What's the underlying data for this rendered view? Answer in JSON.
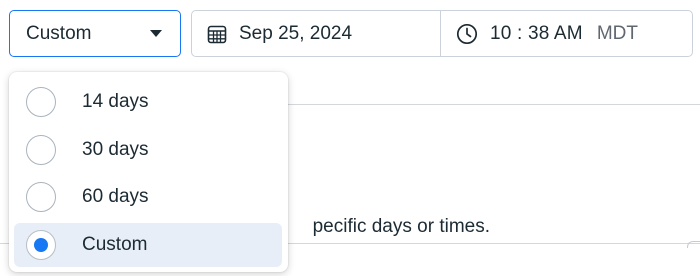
{
  "range_select": {
    "value": "Custom",
    "options": [
      {
        "label": "14 days",
        "selected": false
      },
      {
        "label": "30 days",
        "selected": false
      },
      {
        "label": "60 days",
        "selected": false
      },
      {
        "label": "Custom",
        "selected": true
      }
    ]
  },
  "date": {
    "value": "Sep 25, 2024",
    "icon": "calendar-icon"
  },
  "time": {
    "value": "10 : 38 AM",
    "timezone": "MDT",
    "icon": "clock-icon"
  },
  "background": {
    "partial_text": "pecific days or times."
  },
  "colors": {
    "accent": "#1877f2",
    "selected_bg": "#e7eef7",
    "text": "#1c2b33",
    "muted": "#606770"
  }
}
